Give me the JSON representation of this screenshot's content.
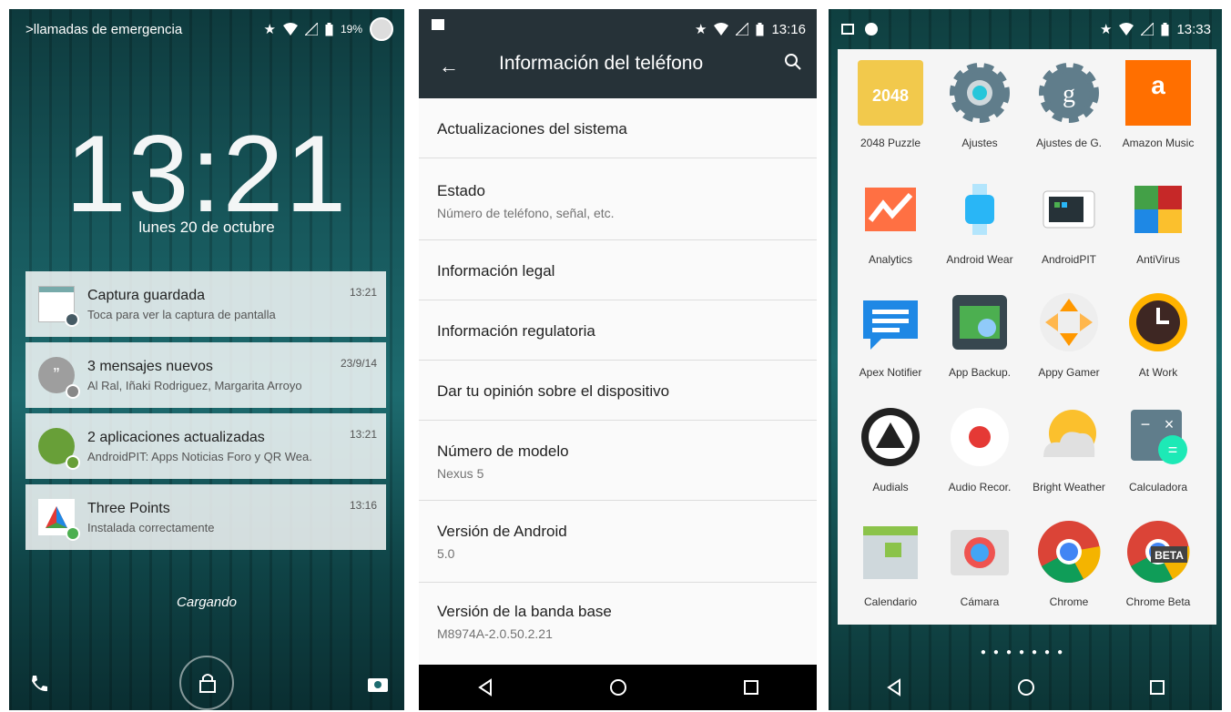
{
  "lock": {
    "status_left": ">llamadas de emergencia",
    "battery": "19%",
    "time_hours": "13",
    "time_minutes": "21",
    "date": "lunes 20 de octubre",
    "charging": "Cargando",
    "notifications": [
      {
        "title": "Captura guardada",
        "subtitle": "Toca para ver la captura de pantalla",
        "time": "13:21"
      },
      {
        "title": "3 mensajes nuevos",
        "subtitle": "Al Ral, Iñaki Rodriguez, Margarita Arroyo",
        "time": "23/9/14"
      },
      {
        "title": "2 aplicaciones actualizadas",
        "subtitle": "AndroidPIT: Apps Noticias Foro y QR Wea.",
        "time": "13:21"
      },
      {
        "title": "Three Points",
        "subtitle": "Instalada correctamente",
        "time": "13:16"
      }
    ]
  },
  "about": {
    "status_time": "13:16",
    "title": "Información del teléfono",
    "rows": [
      {
        "primary": "Actualizaciones del sistema",
        "secondary": ""
      },
      {
        "primary": "Estado",
        "secondary": "Número de teléfono, señal, etc."
      },
      {
        "primary": "Información legal",
        "secondary": ""
      },
      {
        "primary": "Información regulatoria",
        "secondary": ""
      },
      {
        "primary": "Dar tu opinión sobre el dispositivo",
        "secondary": ""
      },
      {
        "primary": "Número de modelo",
        "secondary": "Nexus 5"
      },
      {
        "primary": "Versión de Android",
        "secondary": "5.0"
      },
      {
        "primary": "Versión de la banda base",
        "secondary": "M8974A-2.0.50.2.21"
      }
    ]
  },
  "drawer": {
    "status_time": "13:33",
    "apps": [
      {
        "label": "2048 Puzzle",
        "icon_text": "2048"
      },
      {
        "label": "Ajustes",
        "icon_text": ""
      },
      {
        "label": "Ajustes de G.",
        "icon_text": "g"
      },
      {
        "label": "Amazon Music",
        "icon_text": "a"
      },
      {
        "label": "Analytics",
        "icon_text": ""
      },
      {
        "label": "Android Wear",
        "icon_text": ""
      },
      {
        "label": "AndroidPIT",
        "icon_text": ""
      },
      {
        "label": "AntiVirus",
        "icon_text": ""
      },
      {
        "label": "Apex Notifier",
        "icon_text": ""
      },
      {
        "label": "App Backup.",
        "icon_text": ""
      },
      {
        "label": "Appy Gamer",
        "icon_text": ""
      },
      {
        "label": "At Work",
        "icon_text": ""
      },
      {
        "label": "Audials",
        "icon_text": ""
      },
      {
        "label": "Audio Recor.",
        "icon_text": ""
      },
      {
        "label": "Bright Weather",
        "icon_text": ""
      },
      {
        "label": "Calculadora",
        "icon_text": ""
      },
      {
        "label": "Calendario",
        "icon_text": ""
      },
      {
        "label": "Cámara",
        "icon_text": ""
      },
      {
        "label": "Chrome",
        "icon_text": ""
      },
      {
        "label": "Chrome Beta",
        "icon_text": "BETA"
      }
    ]
  },
  "colors": {
    "toolbar": "#263238",
    "teal_bg": "#1d6b6f",
    "accent_green": "#4caf50"
  }
}
